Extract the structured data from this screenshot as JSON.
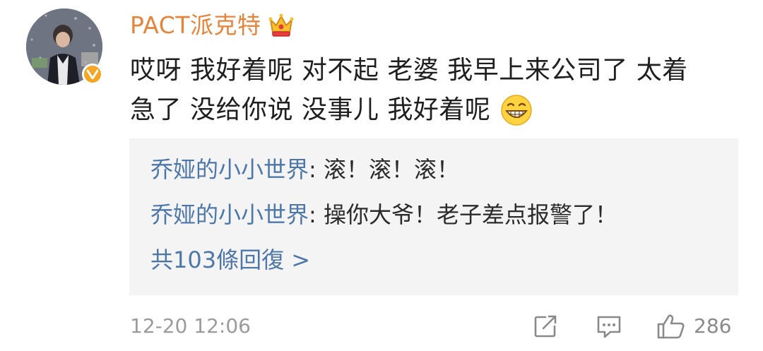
{
  "user": {
    "name": "PACT派克特",
    "avatar_icon": "avatar-photo",
    "badge_icon": "verified-v-icon",
    "vip_icon": "crown-icon"
  },
  "comment": {
    "line1": "哎呀 我好着呢 对不起 老婆 我早上来公司了 太着",
    "line2": "急了 没给你说 没事儿 我好着呢",
    "emoji_icon": "grin-emoji-icon"
  },
  "replies": [
    {
      "user": "乔娅的小小世界",
      "separator": ": ",
      "text": "滚！滚！滚！"
    },
    {
      "user": "乔娅的小小世界",
      "separator": ": ",
      "text": "操你大爷！老子差点报警了！"
    }
  ],
  "reply_count_label": "共103條回復 >",
  "footer": {
    "timestamp": "12-20 12:06",
    "like_count": "286",
    "share_icon": "share-icon",
    "reply_icon": "comment-icon",
    "like_icon": "thumbs-up-icon"
  },
  "colors": {
    "username": "#e8843a",
    "link": "#4e77a9",
    "reply_bg": "#f4f4f4",
    "meta": "#9b9b9b",
    "badge": "#f6a623"
  }
}
